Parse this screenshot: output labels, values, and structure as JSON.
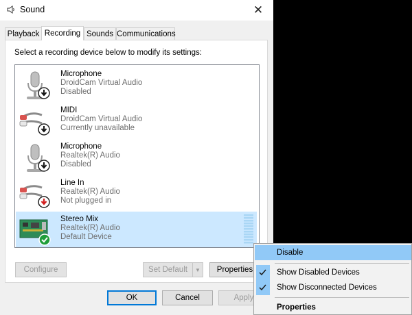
{
  "window": {
    "title": "Sound",
    "close_glyph": "✕"
  },
  "tabs": [
    {
      "label": "Playback",
      "active": false
    },
    {
      "label": "Recording",
      "active": true
    },
    {
      "label": "Sounds",
      "active": false
    },
    {
      "label": "Communications",
      "active": false
    }
  ],
  "instructions": "Select a recording device below to modify its settings:",
  "devices": [
    {
      "name": "Microphone",
      "driver": "DroidCam Virtual Audio",
      "status": "Disabled",
      "icon": "microphone-icon",
      "badge": "down-arrow-disabled-badge",
      "selected": false
    },
    {
      "name": "MIDI",
      "driver": "DroidCam Virtual Audio",
      "status": "Currently unavailable",
      "icon": "audio-cable-icon",
      "badge": "down-arrow-disabled-badge",
      "selected": false
    },
    {
      "name": "Microphone",
      "driver": "Realtek(R) Audio",
      "status": "Disabled",
      "icon": "microphone-icon",
      "badge": "down-arrow-disabled-badge",
      "selected": false
    },
    {
      "name": "Line In",
      "driver": "Realtek(R) Audio",
      "status": "Not plugged in",
      "icon": "audio-cable-icon",
      "badge": "down-arrow-unplugged-badge",
      "selected": false
    },
    {
      "name": "Stereo Mix",
      "driver": "Realtek(R) Audio",
      "status": "Default Device",
      "icon": "sound-card-icon",
      "badge": "default-check-badge",
      "selected": true
    }
  ],
  "buttons": {
    "configure": "Configure",
    "set_default": "Set Default",
    "properties": "Properties",
    "ok": "OK",
    "cancel": "Cancel",
    "apply": "Apply"
  },
  "context_menu": {
    "items": [
      {
        "label": "Disable",
        "checked": false,
        "highlighted": true
      },
      {
        "label": "Show Disabled Devices",
        "checked": true,
        "highlighted": false
      },
      {
        "label": "Show Disconnected Devices",
        "checked": true,
        "highlighted": false
      },
      {
        "label": "Properties",
        "checked": false,
        "highlighted": false,
        "bold": true
      }
    ]
  },
  "colors": {
    "selection": "#cce8ff",
    "menu_highlight": "#91c9f7",
    "accent": "#0078d7",
    "check_green": "#1f9e3a",
    "unplugged_red": "#d21f1f"
  }
}
